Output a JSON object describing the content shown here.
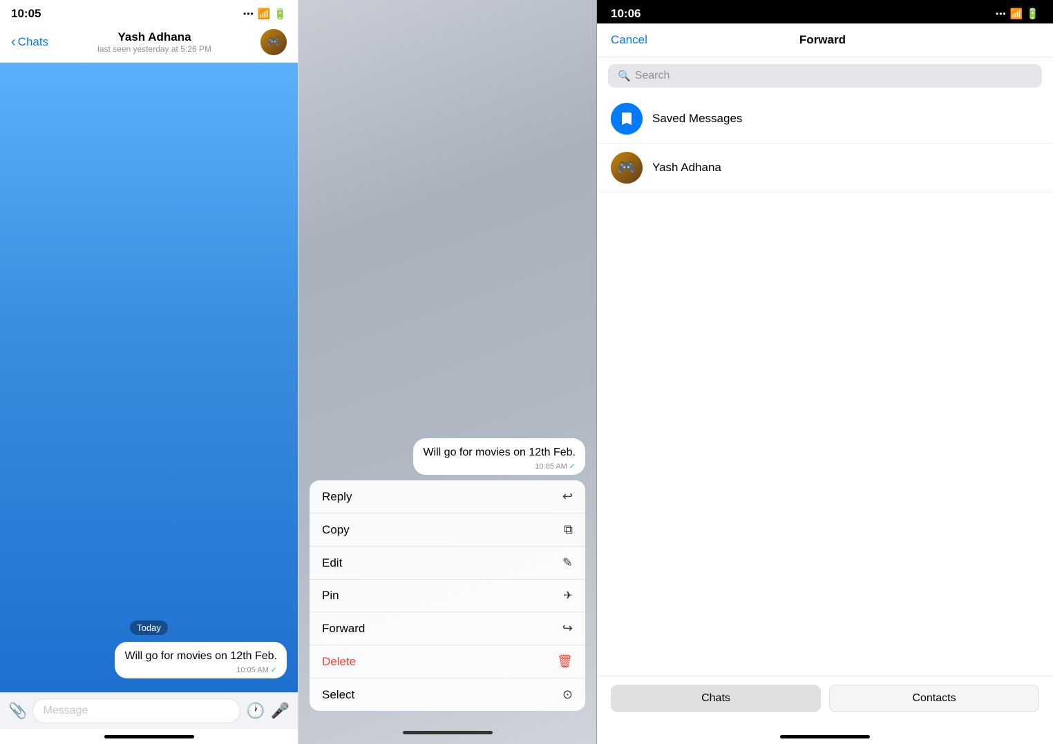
{
  "panel1": {
    "status_time": "10:05",
    "header": {
      "back_label": "Chats",
      "contact_name": "Yash Adhana",
      "contact_status": "last seen yesterday at 5:26 PM"
    },
    "chat": {
      "date_badge": "Today",
      "message_text": "Will go for movies on 12th Feb.",
      "message_time": "10:05 AM"
    },
    "input_placeholder": "Message"
  },
  "panel2": {
    "message_text": "Will go for movies on 12th Feb.",
    "message_time": "10:05 AM",
    "menu_items": [
      {
        "label": "Reply",
        "icon": "↩",
        "style": "normal"
      },
      {
        "label": "Copy",
        "icon": "⧉",
        "style": "normal"
      },
      {
        "label": "Edit",
        "icon": "✎",
        "style": "normal"
      },
      {
        "label": "Pin",
        "icon": "📌",
        "style": "normal"
      },
      {
        "label": "Forward",
        "icon": "↪",
        "style": "normal"
      },
      {
        "label": "Delete",
        "icon": "🗑",
        "style": "delete"
      },
      {
        "label": "Select",
        "icon": "✓",
        "style": "normal"
      }
    ]
  },
  "panel3": {
    "status_time": "10:06",
    "header": {
      "cancel_label": "Cancel",
      "title": "Forward"
    },
    "search_placeholder": "Search",
    "contacts": [
      {
        "name": "Saved Messages",
        "avatar_type": "saved"
      },
      {
        "name": "Yash Adhana",
        "avatar_type": "yash"
      }
    ],
    "tabs": [
      {
        "label": "Chats",
        "active": true
      },
      {
        "label": "Contacts",
        "active": false
      }
    ]
  }
}
